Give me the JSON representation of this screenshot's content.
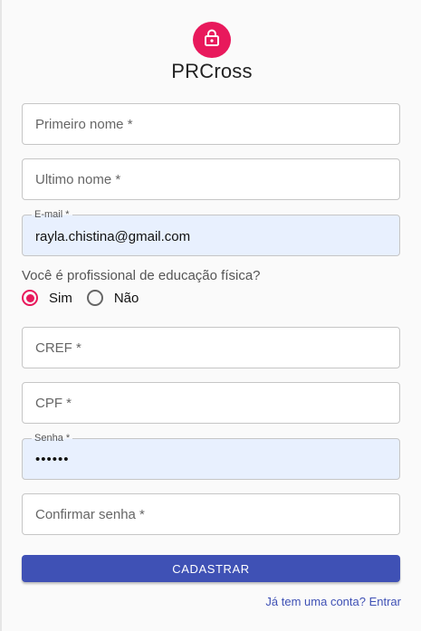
{
  "brand": {
    "title": "PRCross",
    "icon": "lock-icon",
    "accent_color": "#e8195c"
  },
  "form": {
    "first_name": {
      "placeholder": "Primeiro nome *",
      "value": ""
    },
    "last_name": {
      "placeholder": "Ultimo nome *",
      "value": ""
    },
    "email": {
      "label": "E-mail *",
      "value": "rayla.chistina@gmail.com"
    },
    "question": "Você é profissional de educação física?",
    "radio_options": [
      {
        "label": "Sim",
        "checked": true
      },
      {
        "label": "Não",
        "checked": false
      }
    ],
    "cref": {
      "placeholder": "CREF *",
      "value": ""
    },
    "cpf": {
      "placeholder": "CPF *",
      "value": ""
    },
    "password": {
      "label": "Senha *",
      "value": "••••••"
    },
    "confirm_password": {
      "placeholder": "Confirmar senha *",
      "value": ""
    },
    "submit_label": "CADASTRAR",
    "signin_link": "Já tem uma conta? Entrar"
  },
  "colors": {
    "primary": "#3f51b5",
    "accent": "#e8195c",
    "autofill_bg": "#e8f0fe"
  }
}
